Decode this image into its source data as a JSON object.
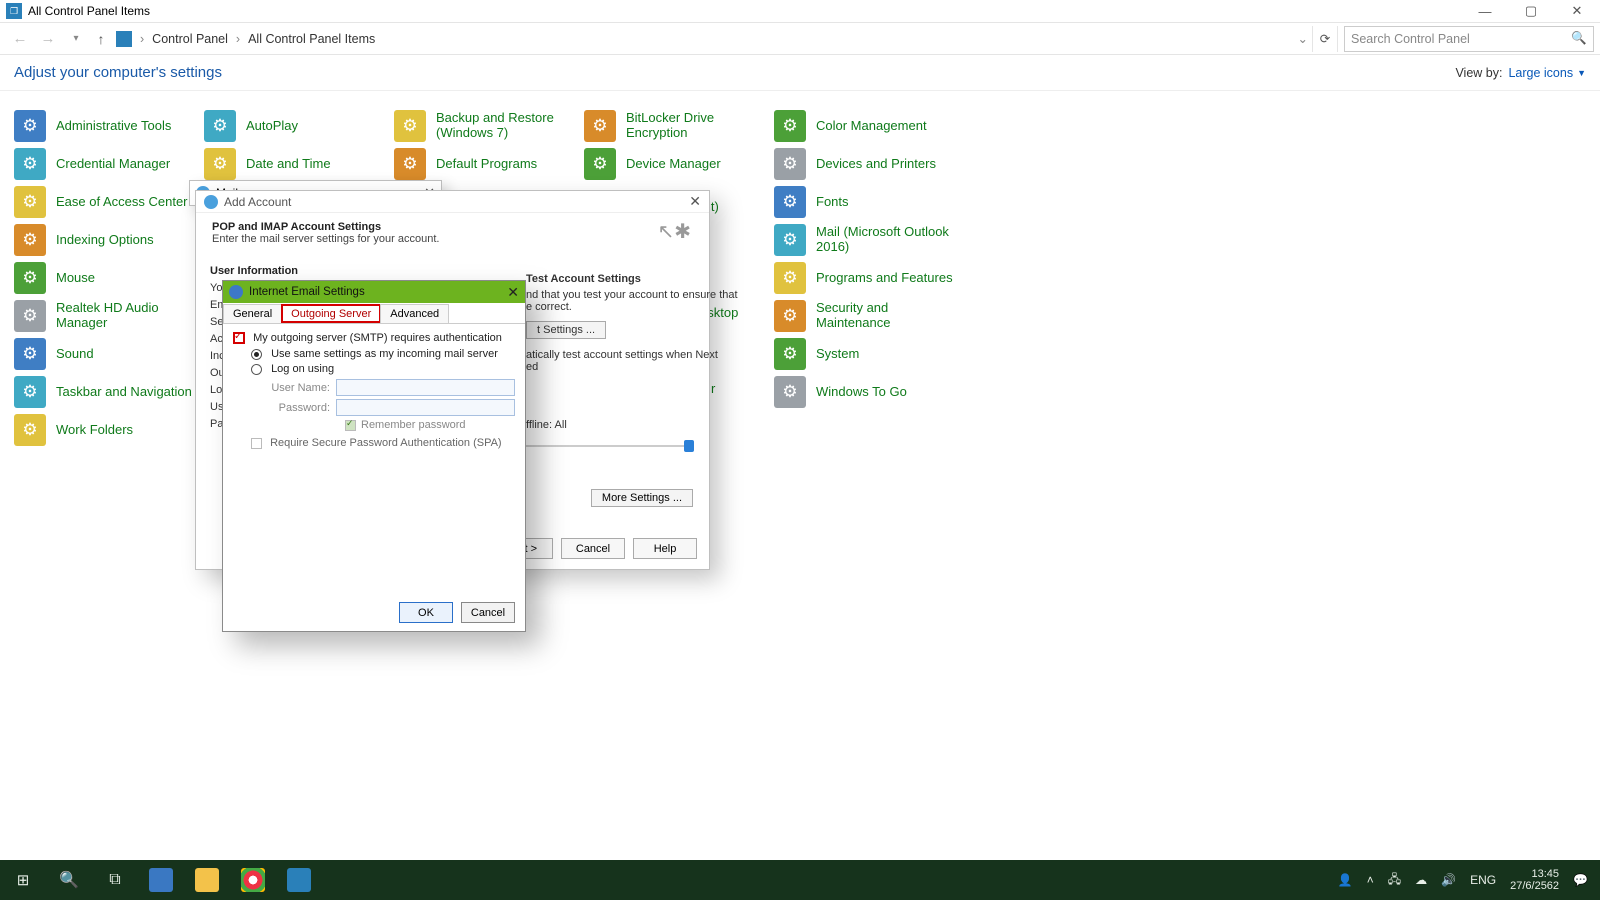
{
  "titlebar": {
    "title": "All Control Panel Items"
  },
  "breadcrumb": {
    "items": [
      "Control Panel",
      "All Control Panel Items"
    ]
  },
  "search": {
    "placeholder": "Search Control Panel"
  },
  "subheader": {
    "adjust": "Adjust your computer's settings",
    "viewby_label": "View by:",
    "viewby_value": "Large icons"
  },
  "cp_items": [
    [
      "Administrative Tools",
      "AutoPlay",
      "Backup and Restore (Windows 7)",
      "BitLocker Drive Encryption",
      "Color Management"
    ],
    [
      "Credential Manager",
      "Date and Time",
      "Default Programs",
      "Device Manager",
      "Devices and Printers"
    ],
    [
      "Ease of Access Center",
      "",
      "",
      "",
      "Fonts"
    ],
    [
      "Indexing Options",
      "",
      "",
      "",
      "Mail (Microsoft Outlook 2016)"
    ],
    [
      "Mouse",
      "",
      "",
      "",
      "Programs and Features"
    ],
    [
      "Realtek HD Audio Manager",
      "",
      "",
      "",
      "Security and Maintenance"
    ],
    [
      "Sound",
      "",
      "",
      "",
      "System"
    ],
    [
      "Taskbar and Navigation",
      "",
      "",
      "",
      "Windows To Go"
    ],
    [
      "Work Folders",
      "",
      "",
      "",
      ""
    ]
  ],
  "cp_extras": {
    "r2c3_suffix": "it)",
    "r4c3_suffix": "esktop",
    "r6c3_suffix": "r"
  },
  "mail_win": {
    "title": "Mail"
  },
  "addacc": {
    "title": "Add Account",
    "head_bold": "POP and IMAP Account Settings",
    "head_sub": "Enter the mail server settings for your account.",
    "left_sections": {
      "user_info": "User Information",
      "lines_left": [
        "You",
        "Ema",
        "Ser",
        "Acc",
        "Inc",
        "Out",
        "Log",
        "Use",
        "Pas"
      ]
    },
    "right": {
      "hdr": "Test Account Settings",
      "desc1": "nd that you test your account to ensure that",
      "desc2": "e correct.",
      "btn": "t Settings ...",
      "auto1": "atically test account settings when Next",
      "auto2": "ed",
      "offline": "ffline:   All"
    },
    "more": "More Settings ...",
    "buttons": {
      "next": "Next >",
      "cancel": "Cancel",
      "help": "Help"
    }
  },
  "ies": {
    "title": "Internet Email Settings",
    "tabs": [
      "General",
      "Outgoing Server",
      "Advanced"
    ],
    "active_tab": 1,
    "chk_main": "My outgoing server (SMTP) requires authentication",
    "radio1": "Use same settings as my incoming mail server",
    "radio2": "Log on using",
    "user_label": "User Name:",
    "pass_label": "Password:",
    "remember": "Remember password",
    "spa": "Require Secure Password Authentication (SPA)",
    "ok": "OK",
    "cancel": "Cancel"
  },
  "taskbar": {
    "lang": "ENG",
    "time": "13:45",
    "date": "27/6/2562"
  }
}
